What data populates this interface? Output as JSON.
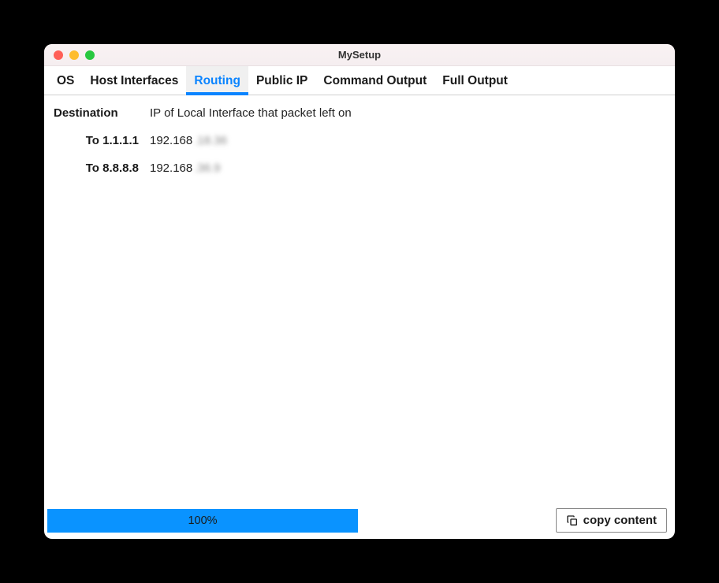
{
  "window": {
    "title": "MySetup"
  },
  "tabs": [
    {
      "label": "OS",
      "active": false
    },
    {
      "label": "Host Interfaces",
      "active": false
    },
    {
      "label": "Routing",
      "active": true
    },
    {
      "label": "Public IP",
      "active": false
    },
    {
      "label": "Command Output",
      "active": false
    },
    {
      "label": "Full Output",
      "active": false
    }
  ],
  "routing": {
    "header_left": "Destination",
    "header_right": "IP of Local Interface that packet left on",
    "rows": [
      {
        "label": "To 1.1.1.1",
        "ip_prefix": "192.168",
        "ip_suffix_blurred": ".18.36"
      },
      {
        "label": "To 8.8.8.8",
        "ip_prefix": "192.168",
        "ip_suffix_blurred": ".36.9"
      }
    ]
  },
  "footer": {
    "progress_text": "100%",
    "copy_label": "copy content"
  }
}
